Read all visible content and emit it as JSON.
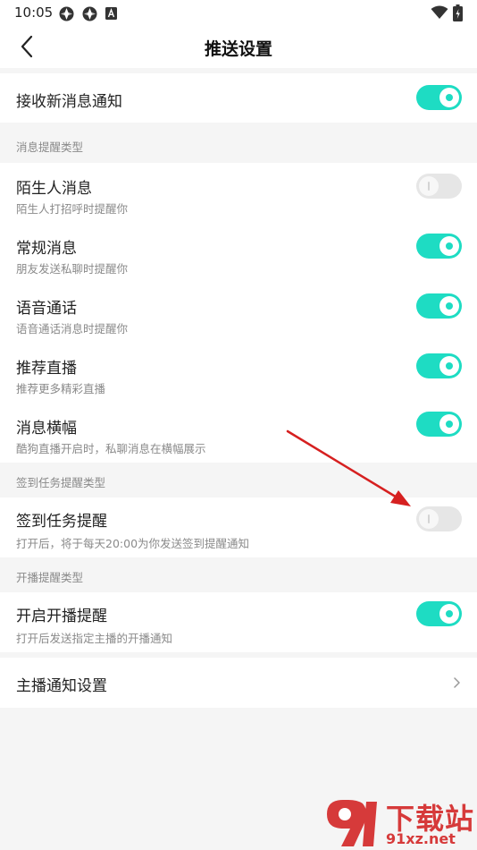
{
  "status_bar": {
    "time": "10:05",
    "icons": [
      "app-icon",
      "app-icon",
      "notification-icon",
      "wifi-icon",
      "battery-icon"
    ]
  },
  "nav": {
    "title": "推送设置",
    "back_icon": "chevron-left-icon"
  },
  "main_toggle": {
    "title": "接收新消息通知",
    "on": true
  },
  "sections": [
    {
      "header": "消息提醒类型",
      "items": [
        {
          "title": "陌生人消息",
          "subtitle": "陌生人打招呼时提醒你",
          "on": false
        },
        {
          "title": "常规消息",
          "subtitle": "朋友发送私聊时提醒你",
          "on": true
        },
        {
          "title": "语音通话",
          "subtitle": "语音通话消息时提醒你",
          "on": true
        },
        {
          "title": "推荐直播",
          "subtitle": "推荐更多精彩直播",
          "on": true
        },
        {
          "title": "消息横幅",
          "subtitle": "酷狗直播开启时，私聊消息在横幅展示",
          "on": true
        }
      ]
    },
    {
      "header": "签到任务提醒类型",
      "items": [
        {
          "title": "签到任务提醒",
          "subtitle": "打开后，将于每天20:00为你发送签到提醒通知",
          "on": false
        }
      ]
    },
    {
      "header": "开播提醒类型",
      "items": [
        {
          "title": "开启开播提醒",
          "subtitle": "打开后发送指定主播的开播通知",
          "on": true
        }
      ]
    }
  ],
  "link_row": {
    "title": "主播通知设置",
    "icon": "chevron-right-icon"
  },
  "watermark": {
    "logo_text": "9",
    "title": "下载站",
    "domain": "91xz.net"
  },
  "colors": {
    "accent": "#1edcc3",
    "toggle_off": "#e6e6e6",
    "background": "#f5f5f5",
    "annotation_arrow": "#d62020"
  }
}
